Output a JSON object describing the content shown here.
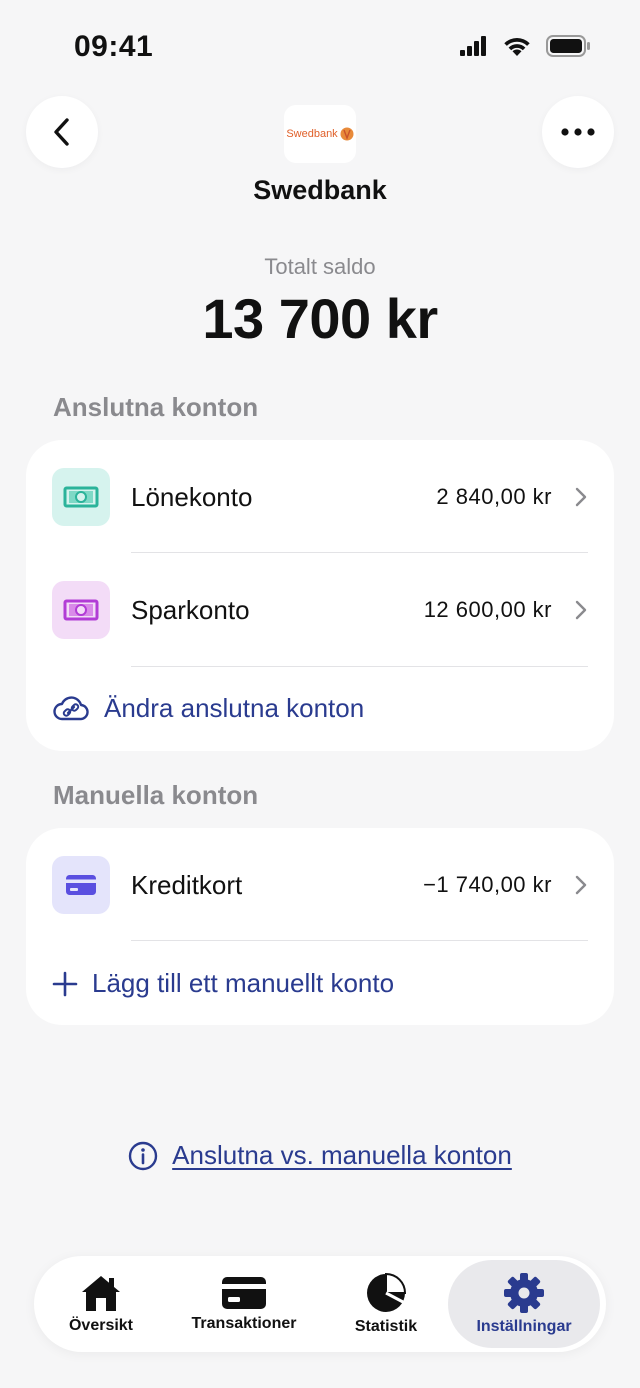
{
  "status_bar": {
    "time": "09:41"
  },
  "header": {
    "bank_logo_text": "Swedbank",
    "bank_name": "Swedbank"
  },
  "balance": {
    "label": "Totalt saldo",
    "value": "13 700 kr"
  },
  "connected": {
    "title": "Anslutna konton",
    "accounts": [
      {
        "name": "Lönekonto",
        "amount": "2 840,00 kr",
        "icon": "banknote-icon",
        "color": "#d6f3ee",
        "icon_color": "#2bb39a"
      },
      {
        "name": "Sparkonto",
        "amount": "12 600,00 kr",
        "icon": "banknote-icon",
        "color": "#f3dcf7",
        "icon_color": "#b23cd6"
      }
    ],
    "action_label": "Ändra anslutna konton"
  },
  "manual": {
    "title": "Manuella konton",
    "accounts": [
      {
        "name": "Kreditkort",
        "amount": "−1 740,00 kr",
        "icon": "credit-card-icon",
        "color": "#e4e4fb",
        "icon_color": "#5a4fe0"
      }
    ],
    "action_label": "Lägg till ett manuellt konto"
  },
  "info_link": "Anslutna vs. manuella konton",
  "tabs": [
    {
      "label": "Översikt",
      "icon": "home-icon"
    },
    {
      "label": "Transaktioner",
      "icon": "card-icon"
    },
    {
      "label": "Statistik",
      "icon": "pie-chart-icon"
    },
    {
      "label": "Inställningar",
      "icon": "gear-icon",
      "active": true
    }
  ],
  "colors": {
    "accent": "#2a3b8f",
    "background": "#f6f6f7"
  }
}
